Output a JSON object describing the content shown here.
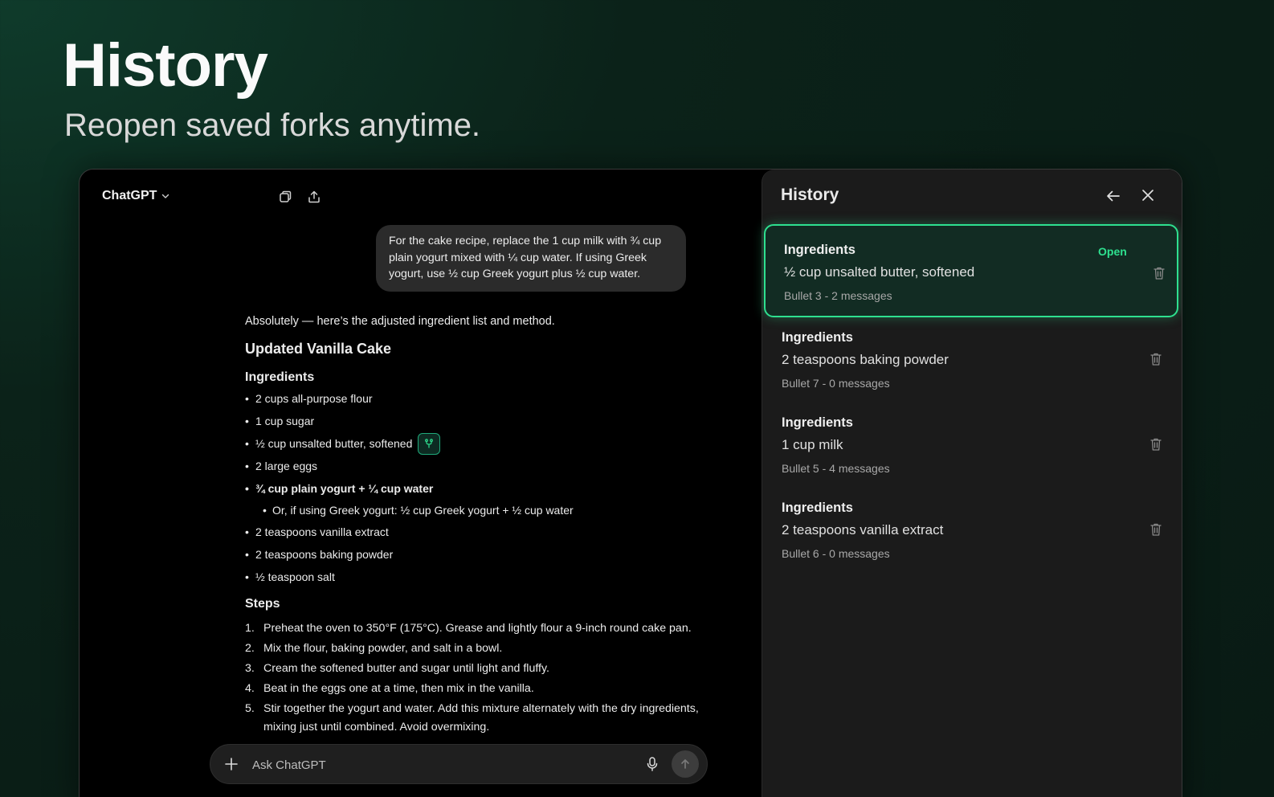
{
  "hero": {
    "title": "History",
    "subtitle": "Reopen saved forks anytime."
  },
  "chat": {
    "app_name": "ChatGPT",
    "icons": [
      "chevron-down-icon",
      "copy-icon",
      "share-icon",
      "plus-icon",
      "mic-icon",
      "arrow-up-icon",
      "fork-icon"
    ],
    "user_message": "For the cake recipe, replace the 1 cup milk with ¾ cup plain yogurt mixed with ¼ cup water. If using Greek yogurt, use ½ cup Greek yogurt plus ½ cup water.",
    "intro": "Absolutely — here’s the adjusted ingredient list and method.",
    "recipe_title": "Updated Vanilla Cake",
    "ingredients_heading": "Ingredients",
    "ingredients": [
      "2 cups all-purpose flour",
      "1 cup sugar",
      "½ cup unsalted butter, softened",
      "2 large eggs",
      "¾ cup plain yogurt + ¼ cup water",
      "Or, if using Greek yogurt: ½ cup Greek yogurt + ½ cup water",
      "2 teaspoons vanilla extract",
      "2 teaspoons baking powder",
      "½ teaspoon salt"
    ],
    "steps_heading": "Steps",
    "steps": [
      {
        "num": "1.",
        "text": "Preheat the oven to 350°F (175°C). Grease and lightly flour a 9-inch round cake pan."
      },
      {
        "num": "2.",
        "text": "Mix the flour, baking powder, and salt in a bowl."
      },
      {
        "num": "3.",
        "text": "Cream the softened butter and sugar until light and fluffy."
      },
      {
        "num": "4.",
        "text": "Beat in the eggs one at a time, then mix in the vanilla."
      },
      {
        "num": "5.",
        "text": "Stir together the yogurt and water. Add this mixture alternately with the dry ingredients, mixing just until combined. Avoid overmixing."
      }
    ],
    "input_placeholder": "Ask ChatGPT"
  },
  "history": {
    "title": "History",
    "open_label": "Open",
    "items": [
      {
        "category": "Ingredients",
        "text": "½ cup unsalted butter, softened",
        "meta": "Bullet 3 - 2 messages",
        "active": true
      },
      {
        "category": "Ingredients",
        "text": "2 teaspoons baking powder",
        "meta": "Bullet 7 - 0 messages",
        "active": false
      },
      {
        "category": "Ingredients",
        "text": "1 cup milk",
        "meta": "Bullet 5 - 4 messages",
        "active": false
      },
      {
        "category": "Ingredients",
        "text": "2 teaspoons vanilla extract",
        "meta": "Bullet 6 - 0 messages",
        "active": false
      }
    ]
  },
  "colors": {
    "accent": "#2ee08f",
    "background": "#0b2219"
  }
}
